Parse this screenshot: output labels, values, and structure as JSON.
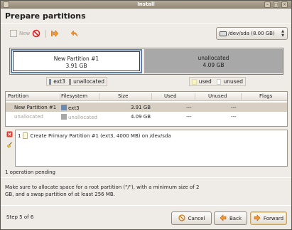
{
  "window": {
    "title": "Install"
  },
  "page": {
    "heading": "Prepare partitions"
  },
  "toolbar": {
    "new_label": "New"
  },
  "device": {
    "selected": "/dev/sda  (8.00 GB)"
  },
  "partition_bar": {
    "partitions": [
      {
        "name": "New Partition #1",
        "size": "3.91 GB"
      },
      {
        "name": "unallocated",
        "size": "4.09 GB"
      }
    ]
  },
  "legend_left": {
    "items": [
      "ext3",
      "unallocated"
    ]
  },
  "legend_right": {
    "items": [
      "used",
      "unused"
    ]
  },
  "table": {
    "headers": [
      "Partition",
      "Filesystem",
      "Size",
      "Used",
      "Unused",
      "Flags"
    ],
    "rows": [
      {
        "partition": "New Partition #1",
        "filesystem": "ext3",
        "size": "3.91 GB",
        "used": "---",
        "unused": "---",
        "flags": ""
      },
      {
        "partition": "unallocated",
        "filesystem": "unallocated",
        "size": "4.09 GB",
        "used": "---",
        "unused": "---",
        "flags": ""
      }
    ]
  },
  "operations": {
    "items": [
      {
        "index": "1",
        "text": "Create Primary Partition #1 (ext3, 4000 MB) on /dev/sda"
      }
    ],
    "pending": "1 operation pending"
  },
  "note": "Make sure to allocate space for a root partition (\"/\"), with a minimum size of 2 GB, and a swap partition of at least 256 MB.",
  "footer": {
    "step": "Step 5 of 6",
    "cancel_label": "Cancel",
    "back_label": "Back",
    "forward_label": "Forward"
  },
  "colors": {
    "ext3": "#6d89ad",
    "unallocated": "#a8a8a8",
    "used": "#f8f4c4",
    "unused": "#ffffff",
    "selection": "#d7cfc2"
  }
}
